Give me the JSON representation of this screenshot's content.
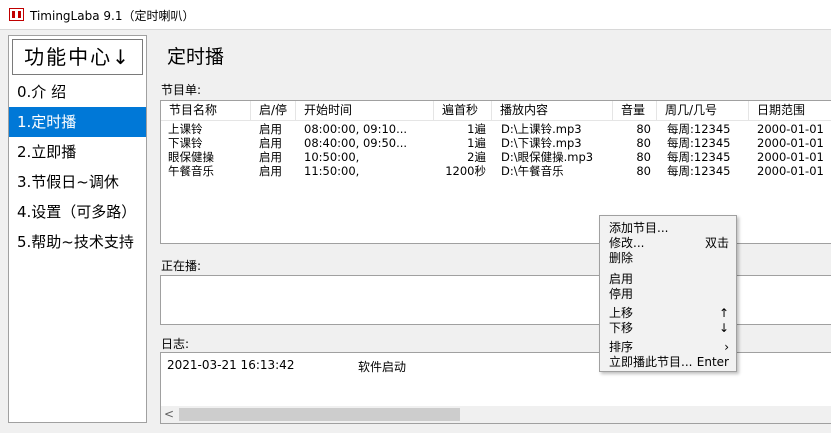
{
  "window": {
    "title": "TimingLaba 9.1（定时喇叭）",
    "app_icon": "app-icon"
  },
  "sidebar": {
    "header": "功能中心↓",
    "items": [
      "0.介 绍",
      "1.定时播",
      "2.立即播",
      "3.节假日~调休",
      "4.设置（可多路）",
      "5.帮助~技术支持"
    ],
    "selected_index": 1
  },
  "main": {
    "page_title": "定时播",
    "program_list_label": "节目单:",
    "columns": [
      "节目名称",
      "启/停",
      "开始时间",
      "遍首秒",
      "播放内容",
      "音量",
      "周几/几号",
      "日期范围"
    ],
    "rows": [
      [
        "上课铃",
        "启用",
        "08:00:00, 09:10...",
        "1遍",
        "D:\\上课铃.mp3",
        "80",
        "每周:12345",
        "2000-01-01"
      ],
      [
        "下课铃",
        "启用",
        "08:40:00, 09:50...",
        "1遍",
        "D:\\下课铃.mp3",
        "80",
        "每周:12345",
        "2000-01-01"
      ],
      [
        "眼保健操",
        "启用",
        "10:50:00,",
        "2遍",
        "D:\\眼保健操.mp3",
        "80",
        "每周:12345",
        "2000-01-01"
      ],
      [
        "午餐音乐",
        "启用",
        "11:50:00,",
        "1200秒",
        "D:\\午餐音乐",
        "80",
        "每周:12345",
        "2000-01-01"
      ]
    ],
    "now_playing_label": "正在播:",
    "log_label": "日志:",
    "log_entries": [
      {
        "time": "2021-03-21  16:13:42",
        "message": "软件启动"
      }
    ],
    "scroll_left_icon": "scroll-left-icon"
  },
  "context_menu": {
    "items": [
      {
        "label": "添加节目...",
        "shortcut": ""
      },
      {
        "label": "修改...",
        "shortcut": "双击"
      },
      {
        "label": "删除",
        "shortcut": ""
      },
      {
        "label": "启用",
        "shortcut": ""
      },
      {
        "label": "停用",
        "shortcut": ""
      },
      {
        "label": "上移",
        "shortcut": "↑"
      },
      {
        "label": "下移",
        "shortcut": "↓"
      },
      {
        "label": "排序",
        "shortcut": "›"
      },
      {
        "label": "立即播此节目...",
        "shortcut": "Enter"
      }
    ]
  }
}
